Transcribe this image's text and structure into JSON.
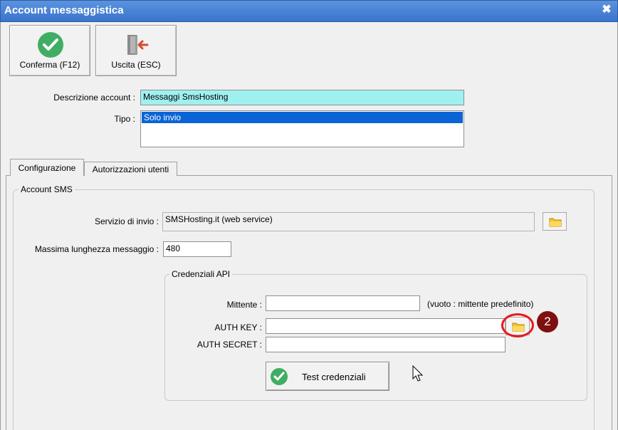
{
  "window": {
    "title": "Account messaggistica",
    "close": "✖"
  },
  "toolbar": {
    "confirm_label": "Conferma (F12)",
    "exit_label": "Uscita (ESC)"
  },
  "form": {
    "description_label": "Descrizione account :",
    "description_value": "Messaggi SmsHosting",
    "type_label": "Tipo :",
    "type_selected": "Solo invio"
  },
  "tabs": [
    {
      "label": "Configurazione"
    },
    {
      "label": "Autorizzazioni utenti"
    }
  ],
  "sms_group": {
    "title": "Account SMS",
    "service_label": "Servizio di invio :",
    "service_value": "SMSHosting.it (web service)",
    "max_len_label": "Massima lunghezza messaggio :",
    "max_len_value": "480"
  },
  "api_group": {
    "title": "Credenziali API",
    "sender_label": "Mittente :",
    "sender_value": "",
    "sender_hint": "(vuoto : mittente predefinito)",
    "auth_key_label": "AUTH KEY :",
    "auth_key_value": "",
    "auth_secret_label": "AUTH SECRET :",
    "auth_secret_value": "",
    "test_label": "Test credenziali"
  },
  "annotation": {
    "badge": "2",
    "ring_color": "#e8191e",
    "badge_color": "#7e1010"
  },
  "colors": {
    "title_bar": "#3a74cc",
    "confirm_green": "#3fae63",
    "selection": "#0a64d6",
    "description_bg": "#9ff1ef"
  }
}
